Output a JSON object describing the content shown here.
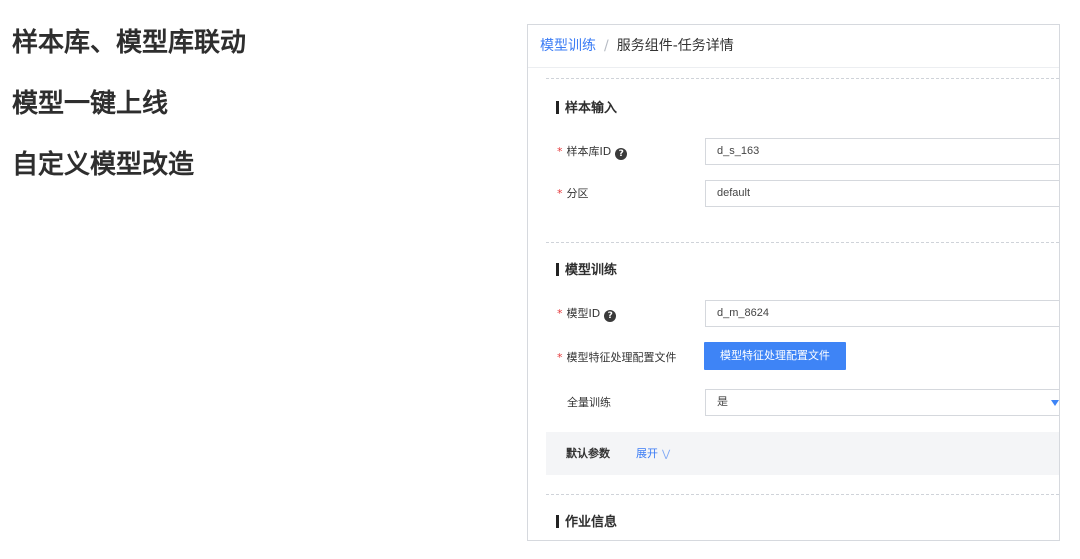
{
  "bullets": [
    "样本库、模型库联动",
    "模型一键上线",
    "自定义模型改造"
  ],
  "breadcrumb": {
    "parent": "模型训练",
    "separator": "/",
    "current": "服务组件-任务详情"
  },
  "sections": {
    "sample": {
      "title": "样本输入",
      "library_id": {
        "label": "样本库ID",
        "value": "d_s_163"
      },
      "partition": {
        "label": "分区",
        "value": "default"
      }
    },
    "model": {
      "title": "模型训练",
      "model_id": {
        "label": "模型ID",
        "value": "d_m_8624"
      },
      "feature_config": {
        "label": "模型特征处理配置文件",
        "button": "模型特征处理配置文件"
      },
      "full_training": {
        "label": "全量训练",
        "value": "是"
      },
      "defaults": {
        "label": "默认参数",
        "expand": "展开"
      }
    },
    "job": {
      "title": "作业信息"
    }
  },
  "icons": {
    "help": "question-circle-icon",
    "chevron": "double-chevron-down-icon",
    "caret": "caret-down-icon"
  },
  "colors": {
    "accent": "#3e84f6",
    "required": "#e5383b"
  }
}
